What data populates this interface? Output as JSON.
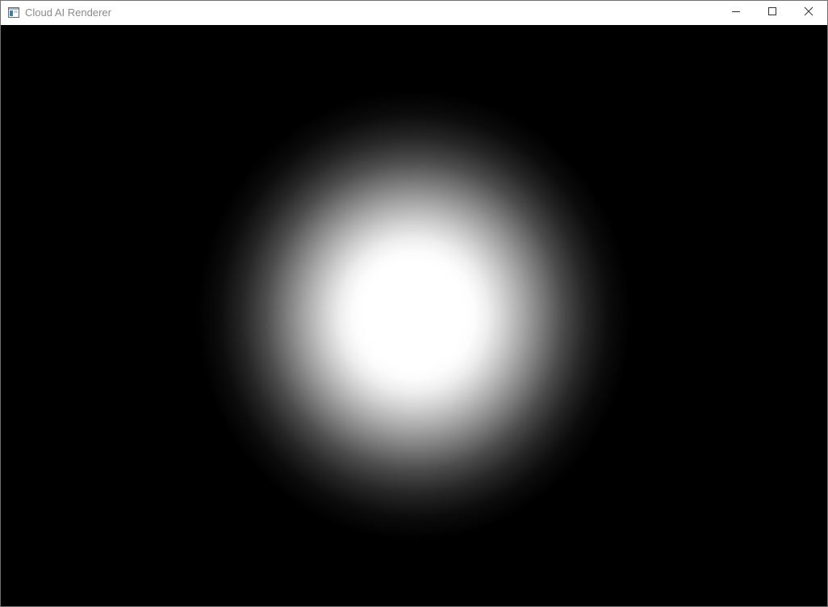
{
  "window": {
    "title": "Cloud AI Renderer",
    "icons": {
      "app": "app-window-icon",
      "minimize": "minimize-icon",
      "maximize": "maximize-icon",
      "close": "close-icon"
    }
  },
  "render": {
    "background_color": "#000000",
    "glow_color": "#ffffff"
  }
}
